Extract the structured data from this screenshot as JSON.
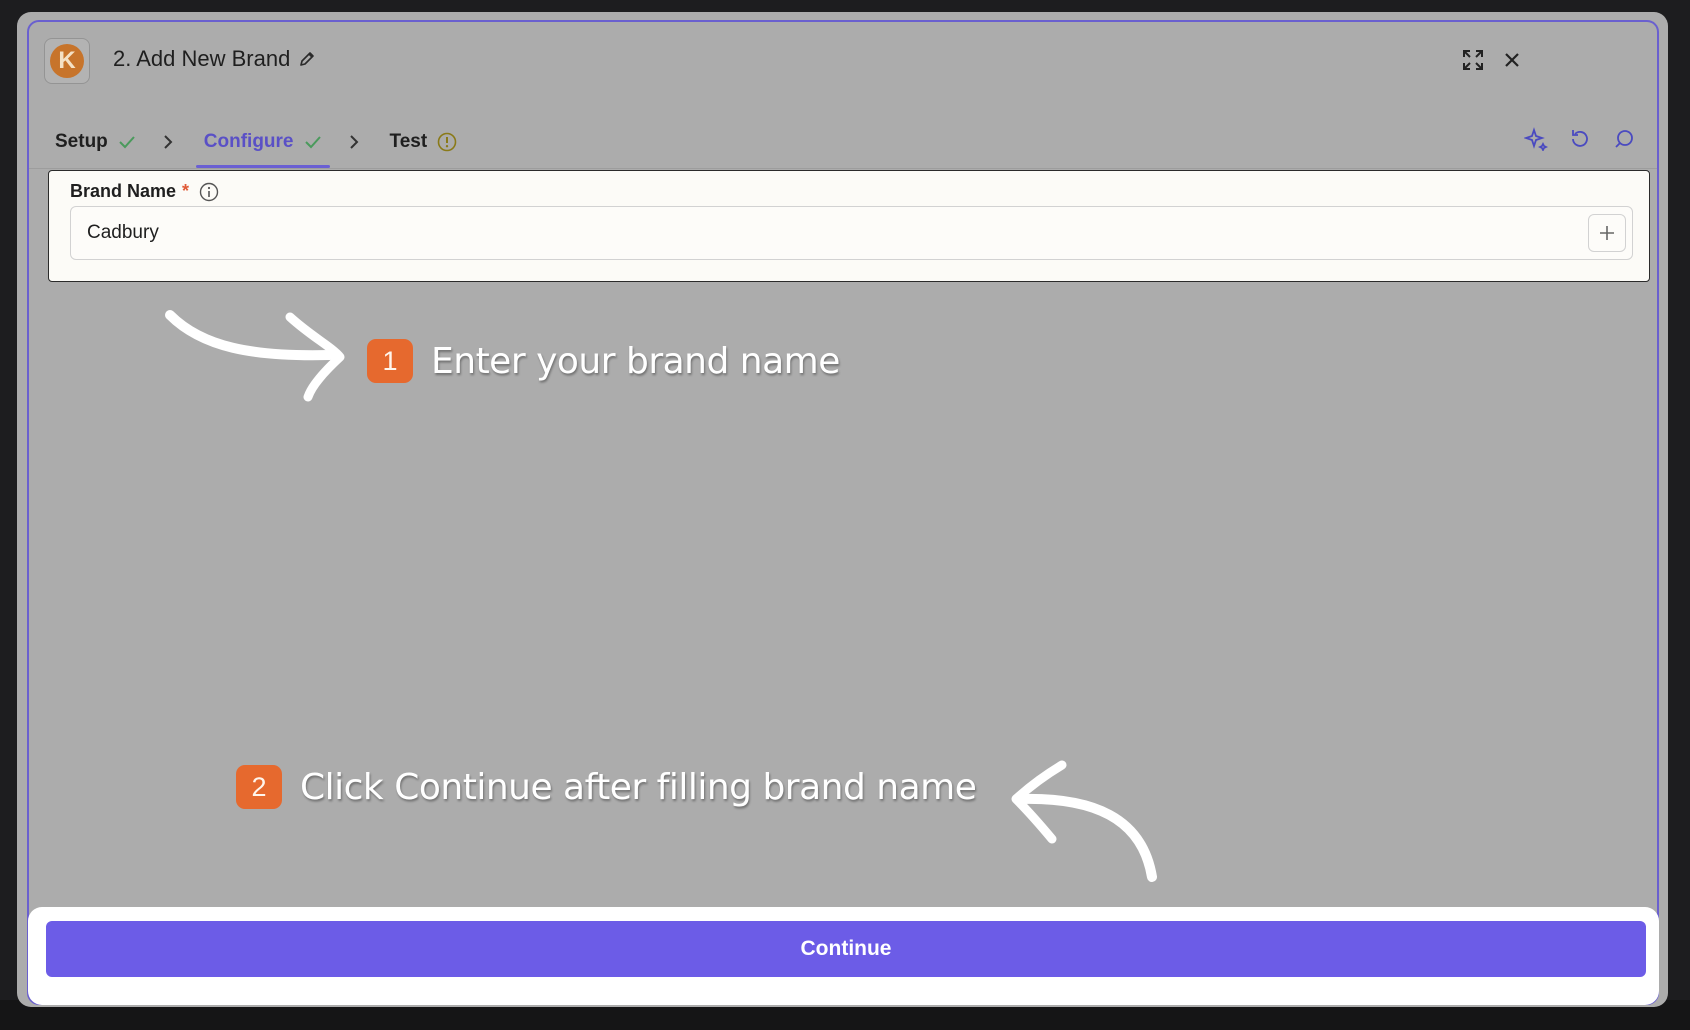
{
  "header": {
    "title": "2. Add New Brand",
    "logo_letter": "K"
  },
  "tabs": [
    {
      "label": "Setup",
      "status": "check"
    },
    {
      "label": "Configure",
      "status": "check",
      "active": true
    },
    {
      "label": "Test",
      "status": "warning"
    }
  ],
  "form": {
    "brand_name_label": "Brand Name",
    "required_mark": "*",
    "brand_name_value": "Cadbury"
  },
  "annotations": {
    "step1_number": "1",
    "step1_text": "Enter your brand name",
    "step2_number": "2",
    "step2_text": "Click Continue after filling brand name"
  },
  "footer": {
    "continue_label": "Continue"
  },
  "colors": {
    "accent": "#6c5ce7",
    "badge": "#e6692e",
    "check": "#4a9a5c",
    "warning": "#8a7a18"
  }
}
